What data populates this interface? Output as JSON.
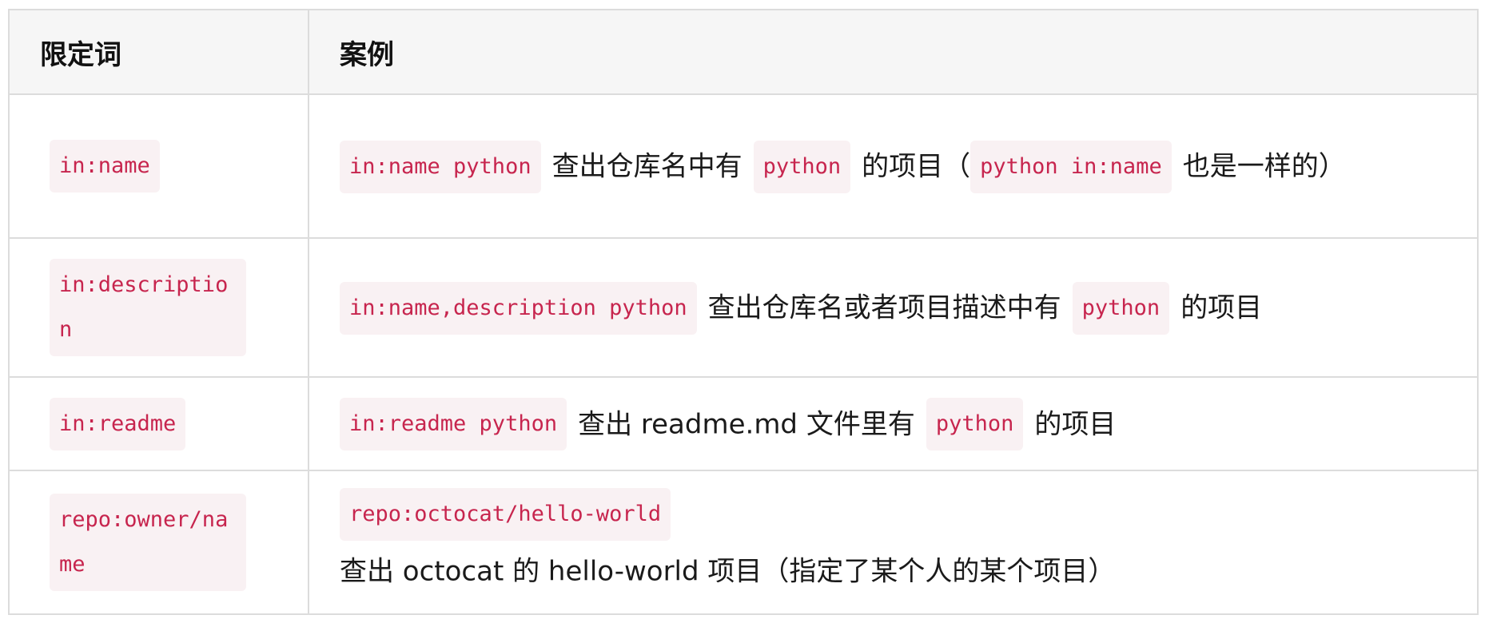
{
  "table": {
    "headers": [
      "限定词",
      "案例"
    ],
    "rows": [
      {
        "qualifier": "in:name",
        "example": [
          {
            "type": "code",
            "text": "in:name python"
          },
          {
            "type": "text",
            "text": "查出仓库名中有"
          },
          {
            "type": "code",
            "text": "python"
          },
          {
            "type": "text",
            "text": "的项目（"
          },
          {
            "type": "code",
            "text": "python in:name"
          },
          {
            "type": "text",
            "text": "也是一样的）"
          }
        ]
      },
      {
        "qualifier": "in:description",
        "example": [
          {
            "type": "code",
            "text": "in:name,description python"
          },
          {
            "type": "text",
            "text": "查出仓库名或者项目描述中有"
          },
          {
            "type": "code",
            "text": "python"
          },
          {
            "type": "text",
            "text": "的项目"
          }
        ]
      },
      {
        "qualifier": "in:readme",
        "example": [
          {
            "type": "code",
            "text": "in:readme python"
          },
          {
            "type": "text",
            "text": "查出 readme.md 文件里有"
          },
          {
            "type": "code",
            "text": "python"
          },
          {
            "type": "text",
            "text": "的项目"
          }
        ]
      },
      {
        "qualifier": "repo:owner/name",
        "example": [
          {
            "type": "code",
            "text": "repo:octocat/hello-world"
          },
          {
            "type": "text",
            "text": "查出 octocat 的 hello-world 项目（指定了某个人的某个项目）"
          }
        ]
      }
    ]
  },
  "colors": {
    "code_bg": "#f9f1f3",
    "code_fg": "#c7254e",
    "border": "#dcdcdc",
    "header_bg": "#f6f6f6"
  }
}
